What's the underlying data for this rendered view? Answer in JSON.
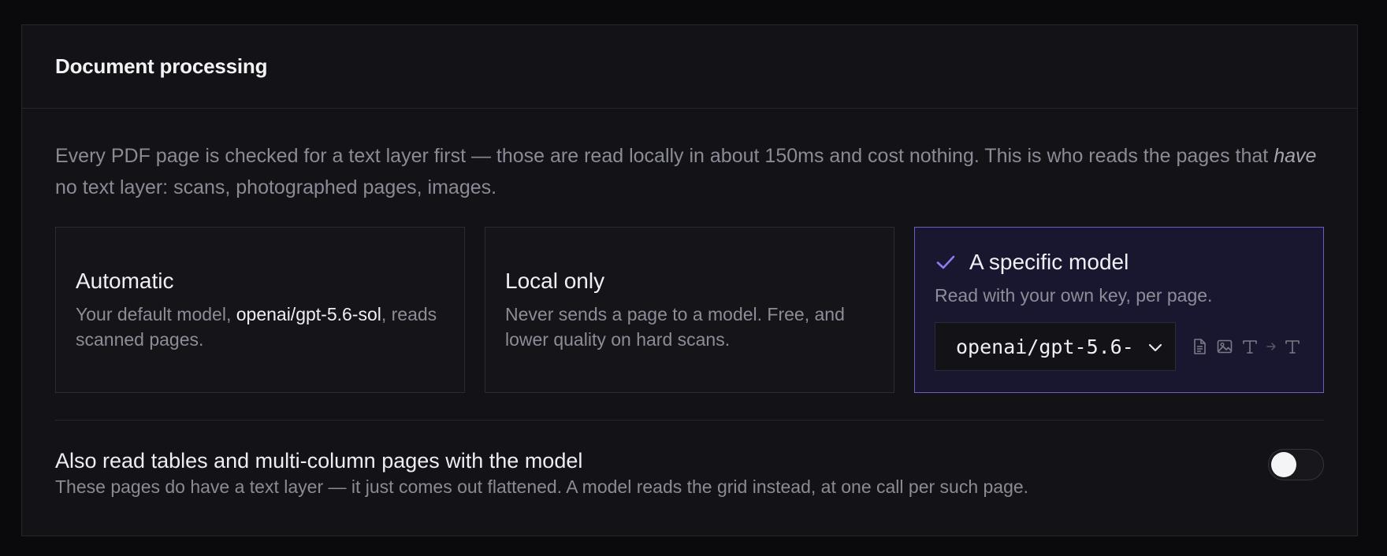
{
  "panel": {
    "title": "Document processing"
  },
  "intro": {
    "part1": "Every PDF page is checked for a text layer first — those are read locally in about 150ms and cost nothing. This is who reads the pages that ",
    "emph": "have",
    "part2": " no text layer: scans, photographed pages, images."
  },
  "options": [
    {
      "title": "Automatic",
      "desc_before": "Your default model, ",
      "desc_highlight": "openai/gpt-5.6-sol",
      "desc_after": ", reads scanned pages.",
      "selected": false
    },
    {
      "title": "Local only",
      "desc": "Never sends a page to a model. Free, and lower quality on hard scans.",
      "selected": false
    },
    {
      "title": "A specific model",
      "desc": "Read with your own key, per page.",
      "selected": true,
      "select_value": "openai/gpt-5.6-",
      "capability_icons": [
        "document-icon",
        "image-icon",
        "text-icon",
        "arrow-right-icon",
        "text-icon"
      ]
    }
  ],
  "tables_toggle": {
    "title": "Also read tables and multi-column pages with the model",
    "desc": "These pages do have a text layer — it just comes out flattened. A model reads the grid instead, at one call per such page.",
    "on": false
  },
  "colors": {
    "accent": "#8b7cf0",
    "selected_bg": "#19172f",
    "selected_border": "#6b5fc4",
    "panel_bg": "#121217",
    "page_bg": "#0a0a0d"
  }
}
